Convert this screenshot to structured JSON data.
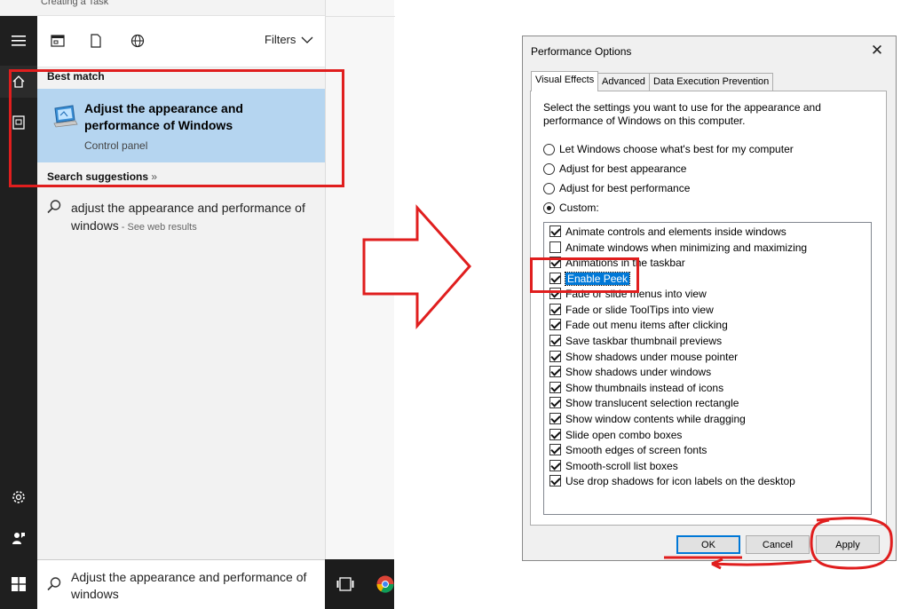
{
  "background": {
    "window_title": "Creating a Task"
  },
  "start_menu": {
    "filters_label": "Filters",
    "best_match_heading": "Best match",
    "best_match": {
      "title": "Adjust the appearance and performance of Windows",
      "subtitle": "Control panel"
    },
    "search_suggestions_heading": "Search suggestions",
    "search_suggestions_more": "»",
    "suggestion": {
      "text": "adjust the appearance and performance of windows",
      "suffix": " - See web results"
    },
    "search_box_text": "Adjust the appearance and performance of windows"
  },
  "dialog": {
    "title": "Performance Options",
    "tabs": [
      "Visual Effects",
      "Advanced",
      "Data Execution Prevention"
    ],
    "active_tab": 0,
    "description": "Select the settings you want to use for the appearance and performance of Windows on this computer.",
    "radios": [
      {
        "label": "Let Windows choose what's best for my computer",
        "checked": false
      },
      {
        "label": "Adjust for best appearance",
        "checked": false
      },
      {
        "label": "Adjust for best performance",
        "checked": false
      },
      {
        "label": "Custom:",
        "checked": true
      }
    ],
    "options": [
      {
        "label": "Animate controls and elements inside windows",
        "checked": true
      },
      {
        "label": "Animate windows when minimizing and maximizing",
        "checked": false
      },
      {
        "label": "Animations in the taskbar",
        "checked": true
      },
      {
        "label": "Enable Peek",
        "checked": true,
        "selected": true
      },
      {
        "label": "Fade or slide menus into view",
        "checked": true
      },
      {
        "label": "Fade or slide ToolTips into view",
        "checked": true
      },
      {
        "label": "Fade out menu items after clicking",
        "checked": true
      },
      {
        "label": "Save taskbar thumbnail previews",
        "checked": true
      },
      {
        "label": "Show shadows under mouse pointer",
        "checked": true
      },
      {
        "label": "Show shadows under windows",
        "checked": true
      },
      {
        "label": "Show thumbnails instead of icons",
        "checked": true
      },
      {
        "label": "Show translucent selection rectangle",
        "checked": true
      },
      {
        "label": "Show window contents while dragging",
        "checked": true
      },
      {
        "label": "Slide open combo boxes",
        "checked": true
      },
      {
        "label": "Smooth edges of screen fonts",
        "checked": true
      },
      {
        "label": "Smooth-scroll list boxes",
        "checked": true
      },
      {
        "label": "Use drop shadows for icon labels on the desktop",
        "checked": true
      }
    ],
    "buttons": {
      "ok": "OK",
      "cancel": "Cancel",
      "apply": "Apply"
    }
  },
  "colors": {
    "annotation": "#e01e1e",
    "highlight": "#b5d5f0",
    "selection": "#0078d7"
  }
}
